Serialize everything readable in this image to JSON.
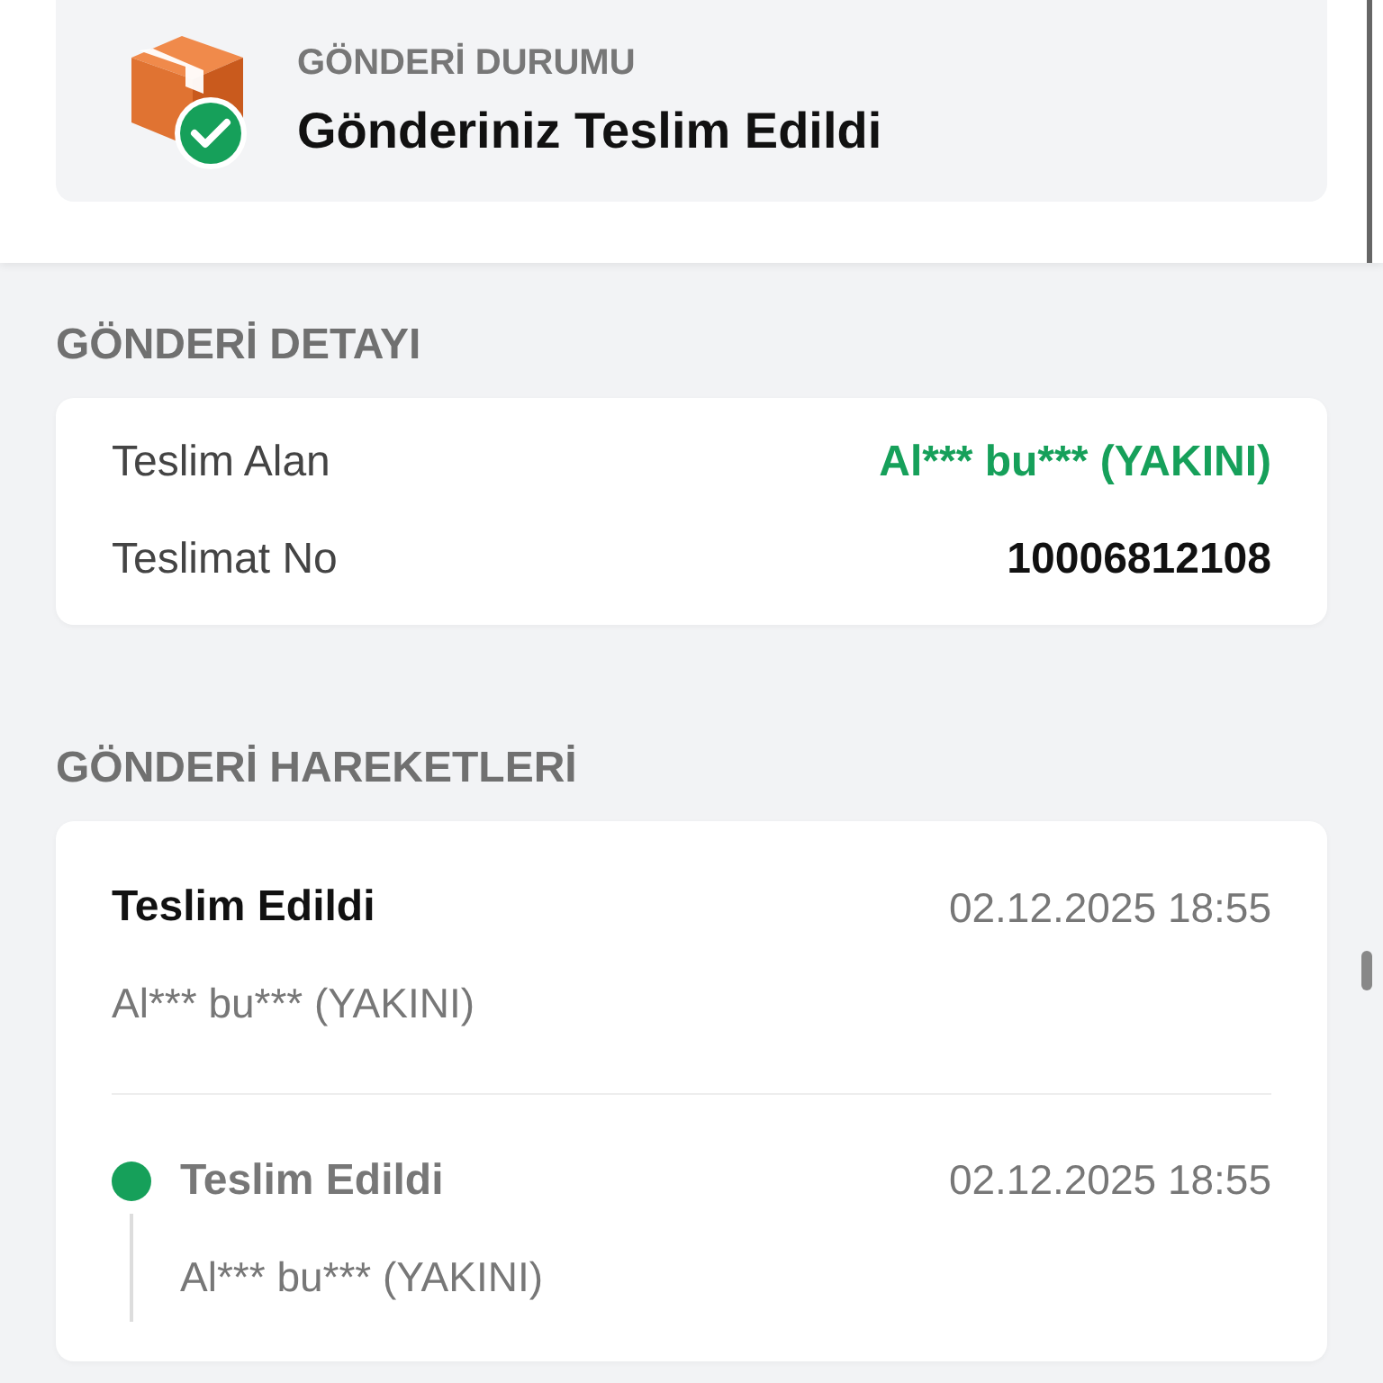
{
  "status": {
    "label": "GÖNDERİ DURUMU",
    "title": "Gönderiniz Teslim Edildi"
  },
  "details": {
    "heading": "GÖNDERİ DETAYI",
    "rows": [
      {
        "label": "Teslim Alan",
        "value": "Al*** bu*** (YAKINI)",
        "kind": "highlight"
      },
      {
        "label": "Teslimat No",
        "value": "10006812108",
        "kind": "plain"
      }
    ]
  },
  "movements": {
    "heading": "GÖNDERİ HAREKETLERİ",
    "latest": {
      "title": "Teslim Edildi",
      "time": "02.12.2025 18:55",
      "subtitle": "Al*** bu*** (YAKINI)"
    },
    "events": [
      {
        "title": "Teslim Edildi",
        "time": "02.12.2025 18:55",
        "subtitle": "Al*** bu*** (YAKINI)",
        "color": "#16a05a"
      }
    ]
  }
}
